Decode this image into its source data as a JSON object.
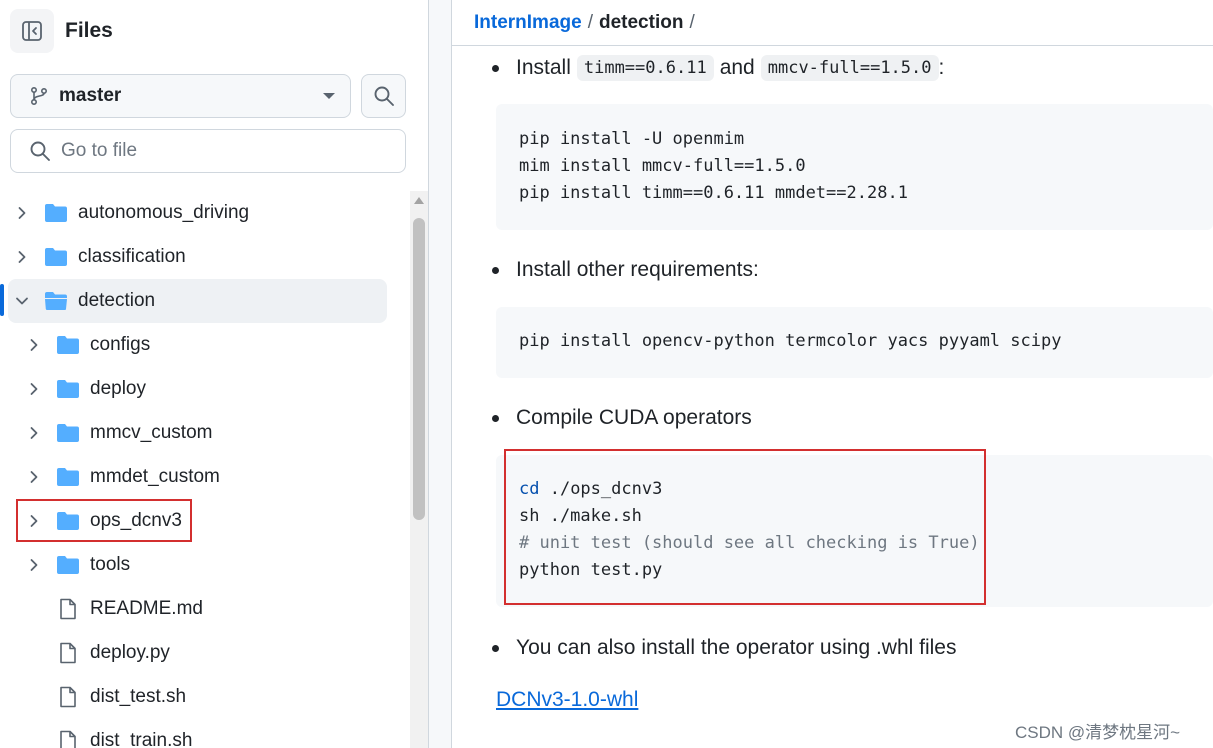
{
  "sidebar": {
    "title": "Files",
    "branch": "master",
    "search_placeholder": "Go to file",
    "tree": [
      {
        "name": "autonomous_driving",
        "type": "folder",
        "depth": 0,
        "expanded": false
      },
      {
        "name": "classification",
        "type": "folder",
        "depth": 0,
        "expanded": false
      },
      {
        "name": "detection",
        "type": "folder",
        "depth": 0,
        "expanded": true,
        "active": true
      },
      {
        "name": "configs",
        "type": "folder",
        "depth": 1,
        "expanded": false
      },
      {
        "name": "deploy",
        "type": "folder",
        "depth": 1,
        "expanded": false
      },
      {
        "name": "mmcv_custom",
        "type": "folder",
        "depth": 1,
        "expanded": false
      },
      {
        "name": "mmdet_custom",
        "type": "folder",
        "depth": 1,
        "expanded": false
      },
      {
        "name": "ops_dcnv3",
        "type": "folder",
        "depth": 1,
        "expanded": false,
        "highlighted": true
      },
      {
        "name": "tools",
        "type": "folder",
        "depth": 1,
        "expanded": false
      },
      {
        "name": "README.md",
        "type": "file",
        "depth": 1
      },
      {
        "name": "deploy.py",
        "type": "file",
        "depth": 1
      },
      {
        "name": "dist_test.sh",
        "type": "file",
        "depth": 1
      },
      {
        "name": "dist_train.sh",
        "type": "file",
        "depth": 1
      }
    ]
  },
  "breadcrumb": {
    "repo": "InternImage",
    "sep": "/",
    "current": "detection",
    "trailing": "/"
  },
  "content": {
    "install_prefix": "Install",
    "install_code1": "timm==0.6.11",
    "install_and": "and",
    "install_code2": "mmcv-full==1.5.0",
    "install_suffix": ":",
    "code1": [
      "pip install -U openmim",
      "mim install mmcv-full==1.5.0",
      "pip install timm==0.6.11 mmdet==2.28.1"
    ],
    "other_req": "Install other requirements:",
    "code2": [
      "pip install opencv-python termcolor yacs pyyaml scipy"
    ],
    "compile": "Compile CUDA operators",
    "code3": {
      "line1_kw": "cd",
      "line1_rest": " ./ops_dcnv3",
      "line2": "sh ./make.sh",
      "line3_comment": "# unit test (should see all checking is True)",
      "line4": "python test.py"
    },
    "whl_text": "You can also install the operator using .whl files",
    "whl_link": "DCNv3-1.0-whl"
  },
  "watermark": "CSDN @清梦枕星河~",
  "colors": {
    "link": "#0969da",
    "folder": "#54aeff",
    "highlight_box": "#d32f2f",
    "active_indicator": "#0969da"
  }
}
